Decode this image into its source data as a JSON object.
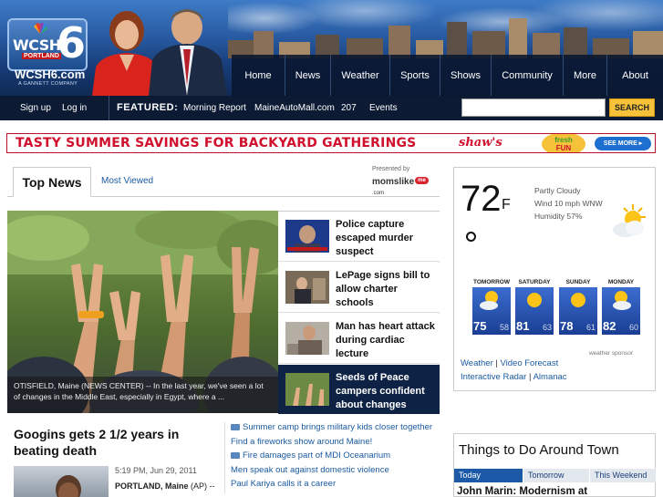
{
  "brand": {
    "call_letters": "WCSH",
    "city": "PORTLAND",
    "channel": "6",
    "site": "WCSH6.com",
    "tagline": "A GANNETT COMPANY"
  },
  "nav": {
    "items": [
      "Home",
      "News",
      "Weather",
      "Sports",
      "Shows",
      "Community",
      "More",
      "About"
    ]
  },
  "subnav": {
    "signup": "Sign up",
    "login": "Log in",
    "featured_label": "FEATURED:",
    "featured_links": [
      "Morning Report",
      "MaineAutoMall.com",
      "207",
      "Events"
    ]
  },
  "search": {
    "placeholder": "",
    "button": "SEARCH"
  },
  "banner": {
    "headline": "TASTY SUMMER SAVINGS FOR BACKYARD GATHERINGS",
    "brand": "shaw's",
    "fresh_top": "fresh",
    "fresh_bottom": "FUN",
    "cta": "SEE MORE ▸"
  },
  "news": {
    "tab_active": "Top News",
    "tab_other": "Most Viewed",
    "presented_by": "Presented by",
    "sponsor_name": "momslike",
    "sponsor_bubble": "me",
    "sponsor_suffix": ".com",
    "caption": "OTISFIELD, Maine (NEWS CENTER) -- In the last year, we've seen a lot of changes in the Middle East, especially in Egypt, where a ...",
    "headlines": [
      "Police capture escaped murder suspect",
      "LePage signs bill to allow charter schools",
      "Man has heart attack during cardiac lecture",
      "Seeds of Peace campers confident about changes"
    ],
    "main_story": {
      "title": "Googins gets 2 1/2 years in beating death",
      "time": "5:19 PM, Jun 29, 2011",
      "dateline": "PORTLAND, Maine",
      "byline_rest": "(AP) --"
    },
    "links": [
      "Summer camp brings military kids closer together",
      "Find a fireworks show around Maine!",
      "Fire damages part of MDI Oceanarium",
      "Men speak out against domestic violence",
      "Paul Kariya calls it a career"
    ]
  },
  "weather": {
    "temp": "72",
    "unit": "F",
    "condition": "Partly Cloudy",
    "wind": "Wind 10 mph WNW",
    "humidity": "Humidity 57%",
    "icon": "partly-cloudy-icon",
    "forecast": [
      {
        "day": "TOMORROW",
        "hi": "75",
        "lo": "58"
      },
      {
        "day": "SATURDAY",
        "hi": "81",
        "lo": "63"
      },
      {
        "day": "SUNDAY",
        "hi": "78",
        "lo": "61"
      },
      {
        "day": "MONDAY",
        "hi": "82",
        "lo": "60"
      }
    ],
    "sponsor": "weather sponsor",
    "links": [
      "Weather",
      "Video Forecast",
      "Interactive Radar",
      "Almanac"
    ]
  },
  "things": {
    "title": "Things to Do Around Town",
    "tabs": [
      "Today",
      "Tomorrow",
      "This Weekend"
    ],
    "story": "John Marin: Modernism at"
  },
  "colors": {
    "nav_bg": "#09162d",
    "subnav_bg": "#0c1a33",
    "link": "#1a5aa0",
    "search_button": "#f6c23a",
    "banner_red": "#d0102c",
    "forecast_blue": "#1a3e92"
  }
}
